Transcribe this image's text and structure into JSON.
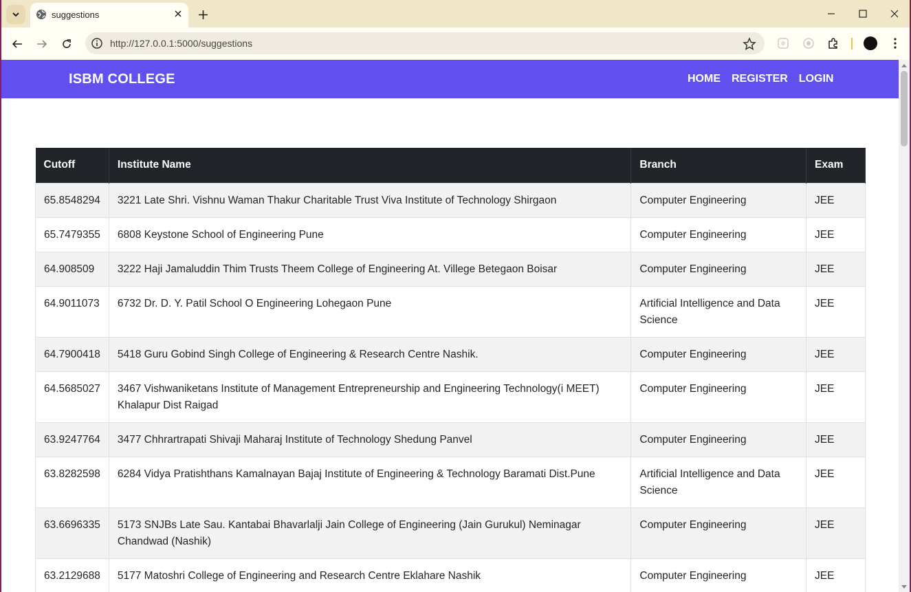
{
  "browser": {
    "tab_title": "suggestions",
    "url": "http://127.0.0.1:5000/suggestions"
  },
  "navbar": {
    "brand": "ISBM COLLEGE",
    "links": [
      "HOME",
      "REGISTER",
      "LOGIN"
    ],
    "color": "#614ff0"
  },
  "table": {
    "headers": [
      "Cutoff",
      "Institute Name",
      "Branch",
      "Exam"
    ],
    "rows": [
      {
        "cutoff": "65.8548294",
        "institute": "3221 Late Shri. Vishnu Waman Thakur Charitable Trust Viva Institute of Technology Shirgaon",
        "branch": "Computer Engineering",
        "exam": "JEE"
      },
      {
        "cutoff": "65.7479355",
        "institute": "6808 Keystone School of Engineering Pune",
        "branch": "Computer Engineering",
        "exam": "JEE"
      },
      {
        "cutoff": "64.908509",
        "institute": "3222 Haji Jamaluddin Thim Trusts Theem College of Engineering At. Villege Betegaon Boisar",
        "branch": "Computer Engineering",
        "exam": "JEE"
      },
      {
        "cutoff": "64.9011073",
        "institute": "6732 Dr. D. Y. Patil School O Engineering Lohegaon Pune",
        "branch": "Artificial Intelligence and Data Science",
        "exam": "JEE"
      },
      {
        "cutoff": "64.7900418",
        "institute": "5418 Guru Gobind Singh College of Engineering & Research Centre Nashik.",
        "branch": "Computer Engineering",
        "exam": "JEE"
      },
      {
        "cutoff": "64.5685027",
        "institute": "3467 Vishwaniketans Institute of Management Entrepreneurship and Engineering Technology(i MEET) Khalapur Dist Raigad",
        "branch": "Computer Engineering",
        "exam": "JEE"
      },
      {
        "cutoff": "63.9247764",
        "institute": "3477 Chhrartrapati Shivaji Maharaj Institute of Technology Shedung Panvel",
        "branch": "Computer Engineering",
        "exam": "JEE"
      },
      {
        "cutoff": "63.8282598",
        "institute": "6284 Vidya Pratishthans Kamalnayan Bajaj Institute of Engineering & Technology Baramati Dist.Pune",
        "branch": "Artificial Intelligence and Data Science",
        "exam": "JEE"
      },
      {
        "cutoff": "63.6696335",
        "institute": "5173 SNJBs Late Sau. Kantabai Bhavarlalji Jain College of Engineering (Jain Gurukul) Neminagar Chandwad (Nashik)",
        "branch": "Computer Engineering",
        "exam": "JEE"
      },
      {
        "cutoff": "63.2129688",
        "institute": "5177 Matoshri College of Engineering and Research Centre Eklahare Nashik",
        "branch": "Computer Engineering",
        "exam": "JEE"
      }
    ]
  }
}
